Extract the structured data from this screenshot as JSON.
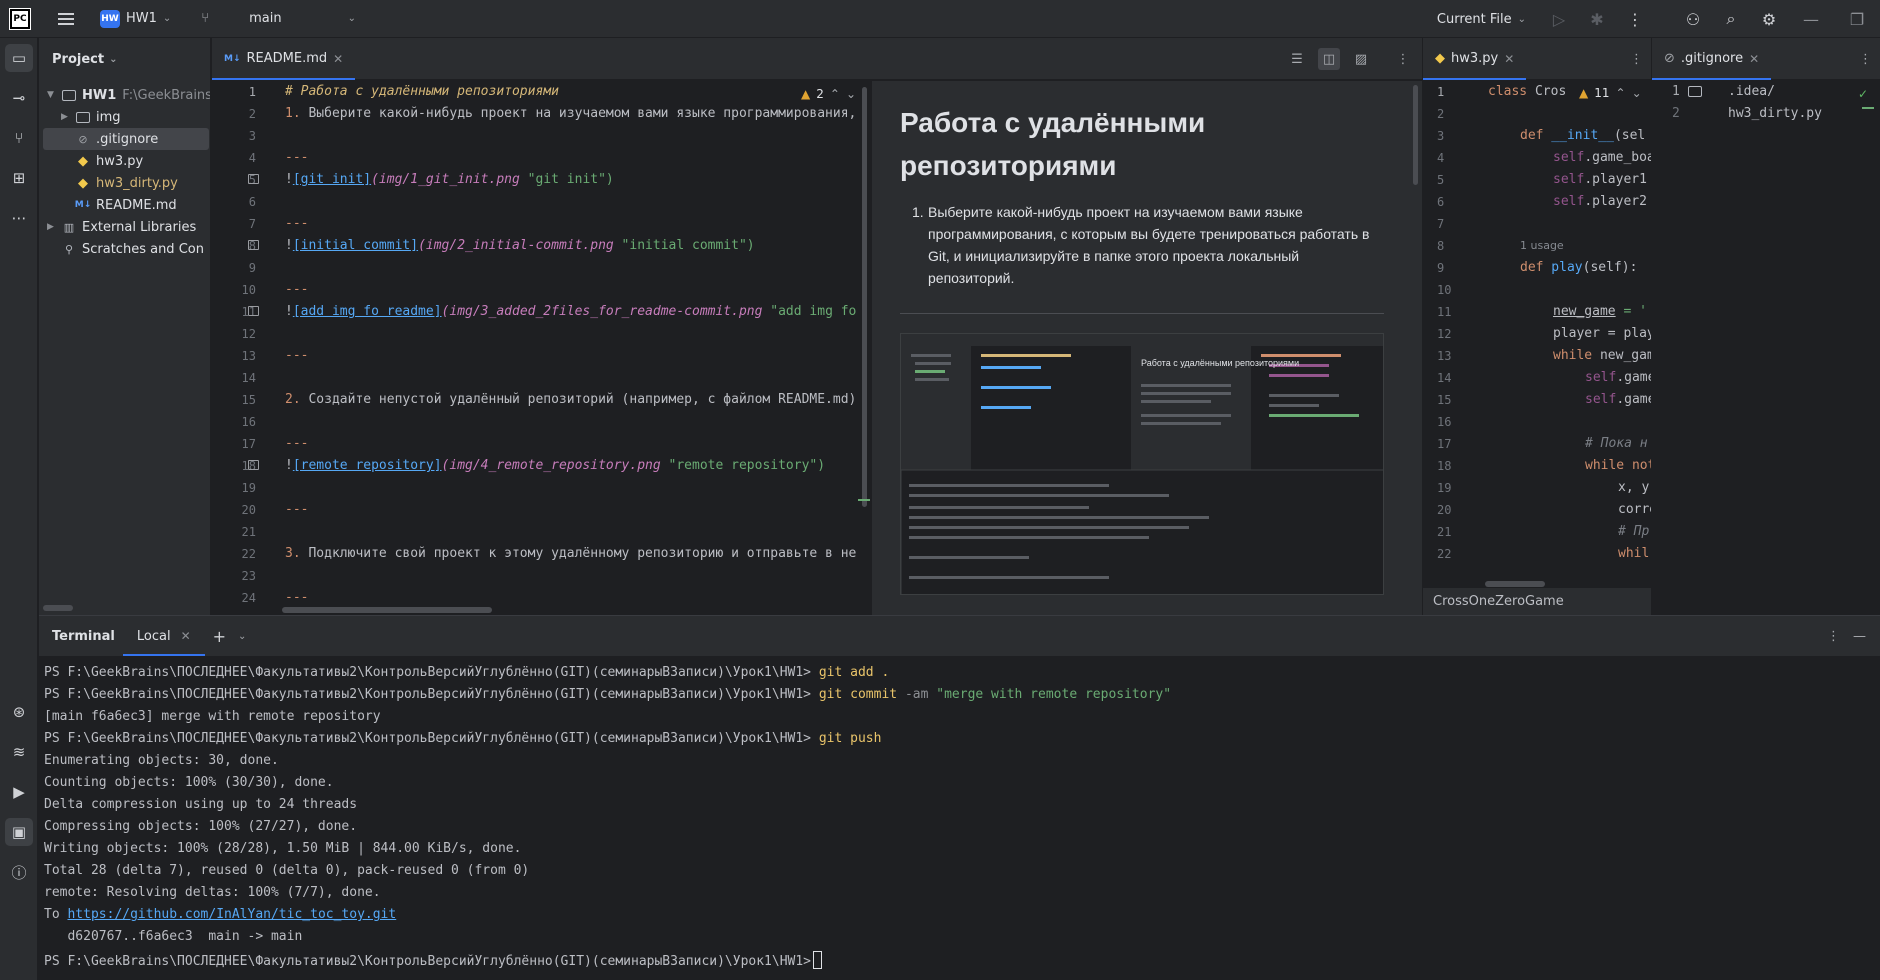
{
  "titlebar": {
    "logo": "PC",
    "project_badge": "HW",
    "project_name": "HW1",
    "branch": "main",
    "run_config": "Current File"
  },
  "project_panel": {
    "title": "Project",
    "items": [
      {
        "label": "HW1",
        "path": "F:\\GeekBrains"
      },
      {
        "label": "img"
      },
      {
        "label": ".gitignore"
      },
      {
        "label": "hw3.py"
      },
      {
        "label": "hw3_dirty.py"
      },
      {
        "label": "README.md"
      },
      {
        "label": "External Libraries"
      },
      {
        "label": "Scratches and Con"
      }
    ]
  },
  "md_tab": {
    "label": "README.md",
    "icon": "M↓",
    "warnings": "2"
  },
  "md_editor": {
    "line_numbers": [
      "1",
      "2",
      "3",
      "4",
      "5",
      "6",
      "7",
      "8",
      "9",
      "10",
      "11",
      "12",
      "13",
      "14",
      "15",
      "16",
      "17",
      "18",
      "19",
      "20",
      "21",
      "22",
      "23",
      "24"
    ],
    "line1": "# Работа с удалёнными репозиториями",
    "line2_num": "1.",
    "line2_text": " Выберите какой-нибудь проект на изучаемом вами языке программирования,",
    "hr": "---",
    "bang": "!",
    "link1": "[git init]",
    "path1": "(img/1_git_init.png",
    "title1": " \"git init\")",
    "link2": "[initial commit]",
    "path2": "(img/2_initial-commit.png",
    "title2": " \"initial commit\")",
    "link3": "[add img fo readme]",
    "path3": "(img/3_added_2files_for_readme-commit.png",
    "title3": " \"add img fo",
    "line15_num": "2.",
    "line15_text": " Создайте непустой удалённый репозиторий (например, с файлом README.md)",
    "link4": "[remote repository]",
    "path4": "(img/4_remote_repository.png",
    "title4": " \"remote repository\")",
    "line22_num": "3.",
    "line22_text": " Подключите свой проект к этому удалённому репозиторию и отправьте в не"
  },
  "md_preview": {
    "title": "Работа с удалёнными репозиториями",
    "item1_num": "1.",
    "item1": "Выберите какой-нибудь проект на изучаемом вами языке программирования, с которым вы будете тренироваться работать в Git, и инициализируйте в папке этого проекта локальный репозиторий.",
    "shot_title": "Работа с удалёнными репозиториями"
  },
  "py_tab": {
    "label": "hw3.py",
    "warnings": "11"
  },
  "py_editor": {
    "line_numbers": [
      "1",
      "2",
      "3",
      "4",
      "5",
      "6",
      "7",
      "8",
      "9",
      "10",
      "11",
      "12",
      "13",
      "14",
      "15",
      "16",
      "17",
      "18",
      "19",
      "20",
      "21",
      "22"
    ],
    "l1_kw": "class",
    "l1_name": " Cros",
    "l3_kw": "def",
    "l3_fn": " __init__",
    "l3_rest": "(sel",
    "l4": "self",
    "l4_rest": ".game_boa",
    "l5": "self",
    "l5_rest": ".player1",
    "l6": "self",
    "l6_rest": ".player2",
    "usage": "1 usage",
    "l8_kw": "def",
    "l8_fn": " play",
    "l8_rest": "(self):",
    "l10_var": "new_game",
    "l10_rest": " = '",
    "l11": "player = play",
    "l12_kw": "while",
    "l12_rest": " new_gam",
    "l13": "self",
    "l13_rest": ".game",
    "l14": "self",
    "l14_rest": ".game",
    "l16": "# Пока н",
    "l17_kw": "while",
    "l17_rest": " not",
    "l18": "x, y",
    "l19": "corre",
    "l20": "# Пр",
    "l21_kw": "whil",
    "status": "CrossOneZeroGame"
  },
  "gi_tab": {
    "label": ".gitignore"
  },
  "gi_editor": {
    "line_numbers": [
      "1",
      "2"
    ],
    "line1": ".idea/",
    "line2": "hw3_dirty.py"
  },
  "terminal": {
    "title": "Terminal",
    "tab": "Local",
    "prompt": "PS F:\\GeekBrains\\ПОСЛЕДНЕЕ\\Факультативы2\\КонтрольВерсийУглублённо(GIT)(семинарыВЗаписи)\\Урок1\\HW1>",
    "cmd1": "git add .",
    "cmd2_a": "git commit",
    "cmd2_flag": "-am",
    "cmd2_str": "\"merge with remote repository\"",
    "out1": "[main f6a6ec3] merge with remote repository",
    "cmd3": "git push",
    "out2": "Enumerating objects: 30, done.",
    "out3": "Counting objects: 100% (30/30), done.",
    "out4": "Delta compression using up to 24 threads",
    "out5": "Compressing objects: 100% (27/27), done.",
    "out6": "Writing objects: 100% (28/28), 1.50 MiB | 844.00 KiB/s, done.",
    "out7": "Total 28 (delta 7), reused 0 (delta 0), pack-reused 0 (from 0)",
    "out8": "remote: Resolving deltas: 100% (7/7), done.",
    "to": "To ",
    "url": "https://github.com/InAlYan/tic_toc_toy.git",
    "out9": "   d620767..f6a6ec3  main -> main"
  }
}
